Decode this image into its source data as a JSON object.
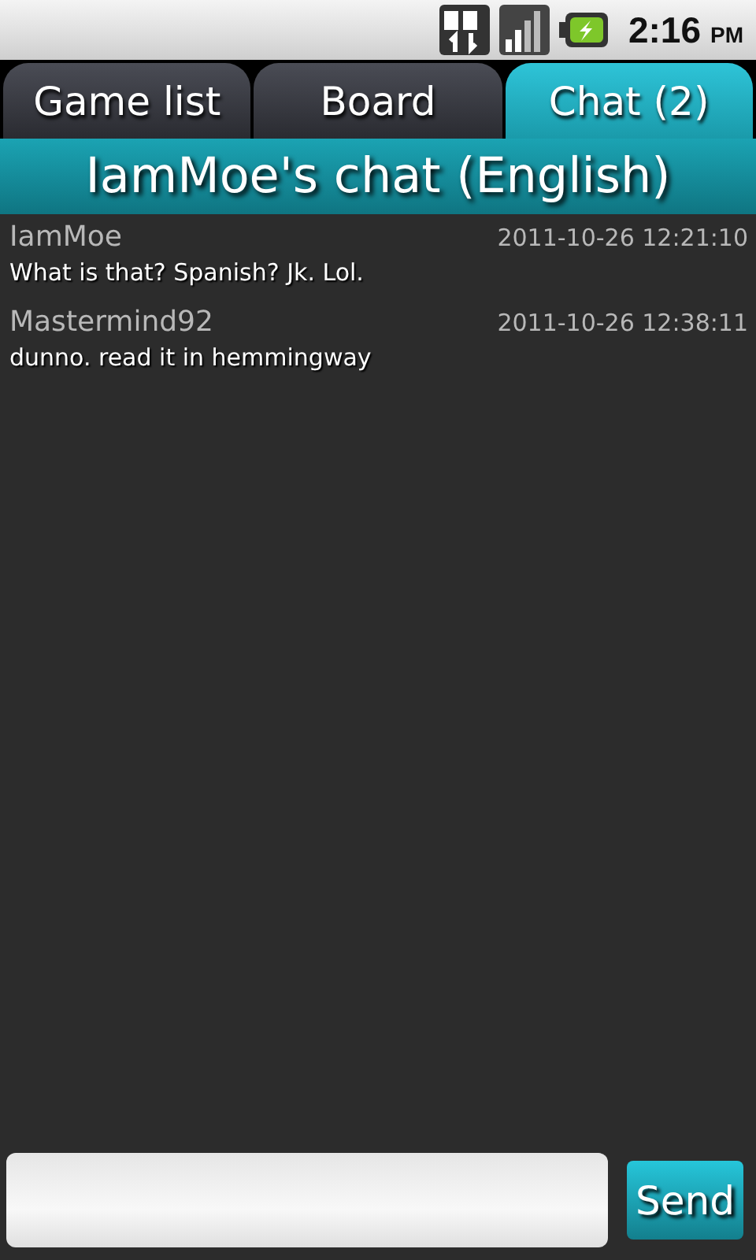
{
  "status_bar": {
    "time": "2:16",
    "ampm": "PM"
  },
  "tabs": [
    {
      "label": "Game list",
      "selected": false
    },
    {
      "label": "Board",
      "selected": false
    },
    {
      "label": "Chat (2)",
      "selected": true
    }
  ],
  "header": {
    "title": "IamMoe's chat (English)"
  },
  "messages": [
    {
      "author": "IamMoe",
      "timestamp": "2011-10-26 12:21:10",
      "text": "What is that? Spanish? Jk. Lol."
    },
    {
      "author": "Mastermind92",
      "timestamp": "2011-10-26 12:38:11",
      "text": "dunno. read it in hemmingway"
    }
  ],
  "composer": {
    "button": "Send"
  }
}
